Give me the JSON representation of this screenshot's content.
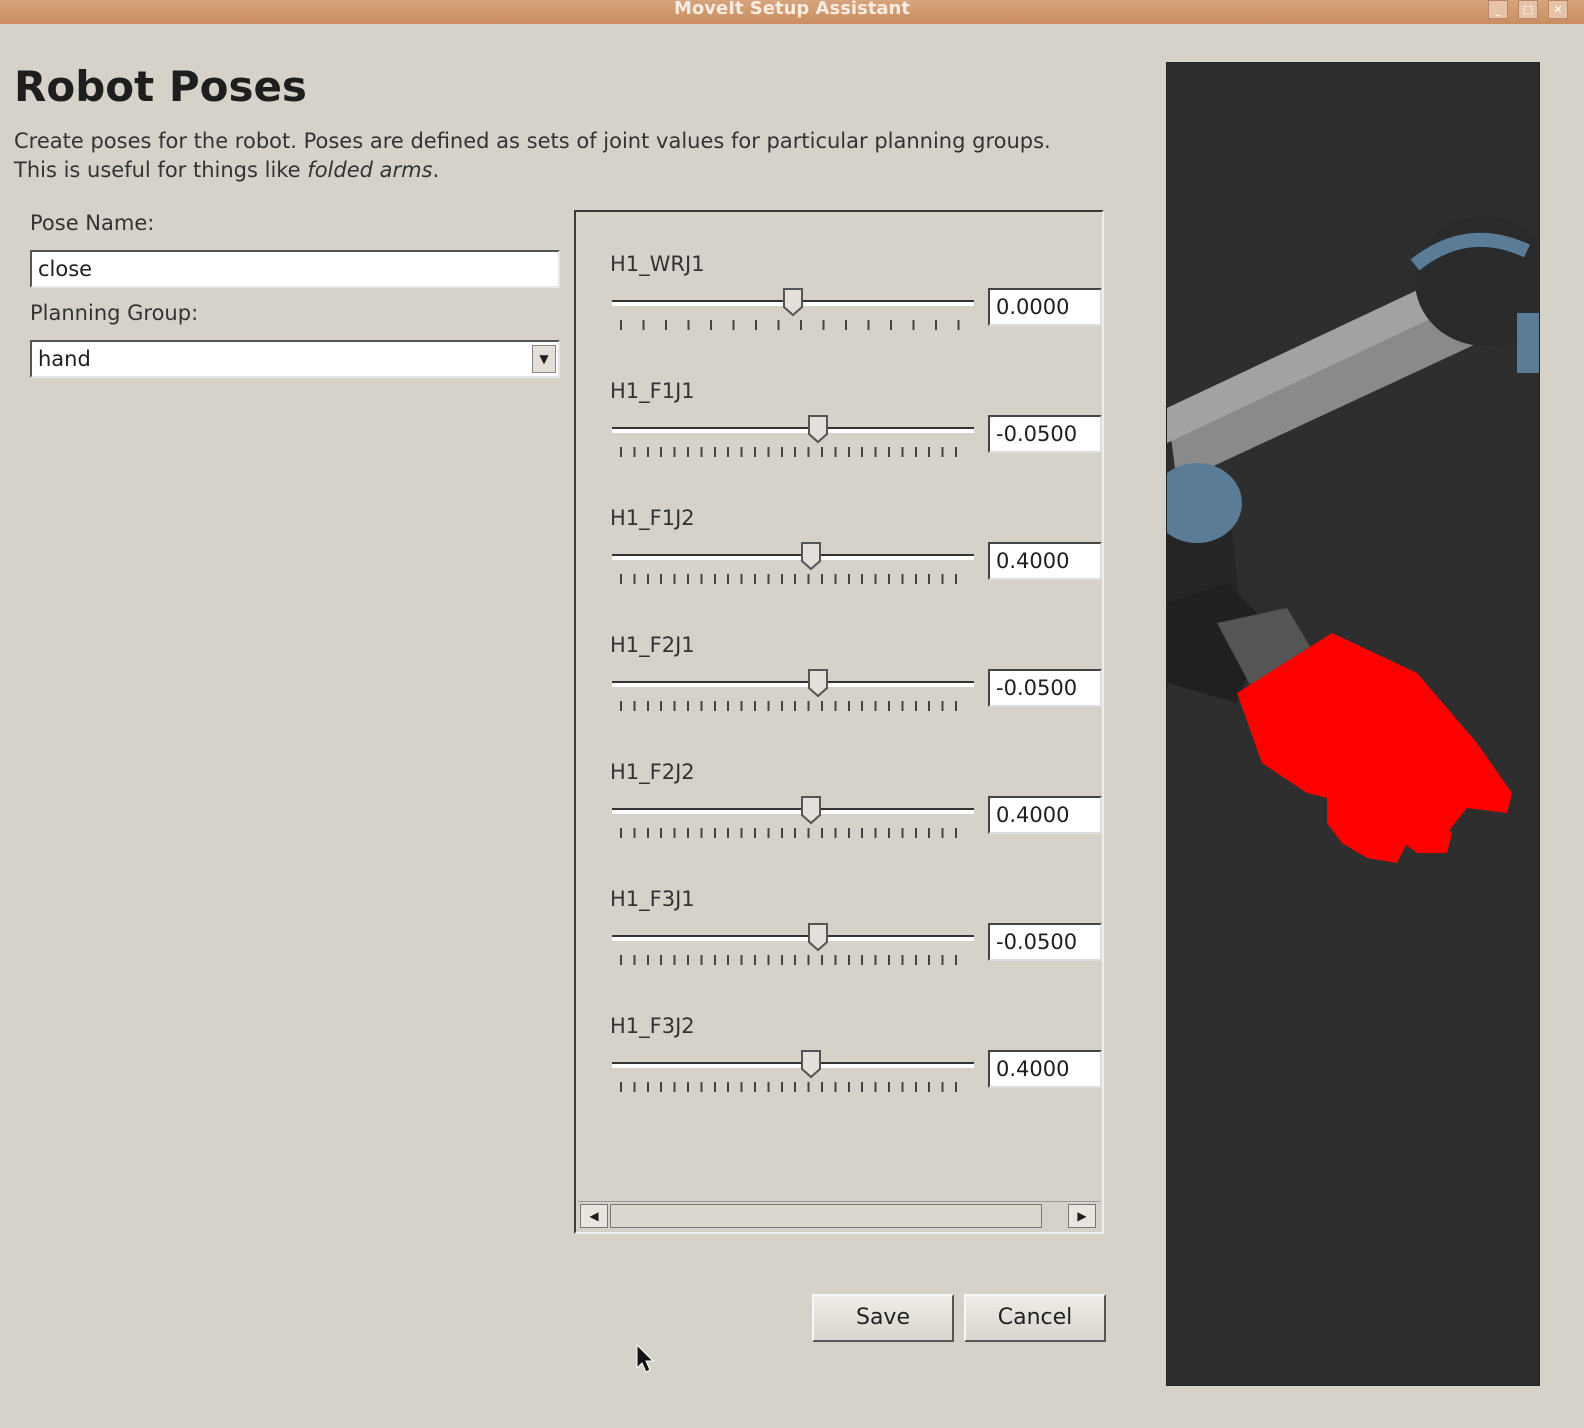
{
  "window": {
    "title": "MoveIt Setup Assistant",
    "controls": [
      "_",
      "□",
      "✕"
    ]
  },
  "page": {
    "title": "Robot Poses",
    "description_1": "Create poses for the robot. Poses are defined as sets of joint values for particular planning groups.",
    "description_2a": "This is useful for things like ",
    "description_2b": "folded arms",
    "description_2c": "."
  },
  "form": {
    "pose_name_label": "Pose Name:",
    "pose_name_value": "close",
    "planning_group_label": "Planning Group:",
    "planning_group_value": "hand"
  },
  "joints": [
    {
      "name": "H1_WRJ1",
      "value": "0.0000",
      "level": 0.5
    },
    {
      "name": "H1_F1J1",
      "value": "-0.0500",
      "level": 0.57
    },
    {
      "name": "H1_F1J2",
      "value": "0.4000",
      "level": 0.55
    },
    {
      "name": "H1_F2J1",
      "value": "-0.0500",
      "level": 0.57
    },
    {
      "name": "H1_F2J2",
      "value": "0.4000",
      "level": 0.55
    },
    {
      "name": "H1_F3J1",
      "value": "-0.0500",
      "level": 0.57
    },
    {
      "name": "H1_F3J2",
      "value": "0.4000",
      "level": 0.55
    }
  ],
  "buttons": {
    "save": "Save",
    "cancel": "Cancel"
  },
  "colors": {
    "highlight_link": "#ff0000",
    "viewport_bg": "#2e2e2e",
    "joint_accent": "#5a7c96"
  }
}
